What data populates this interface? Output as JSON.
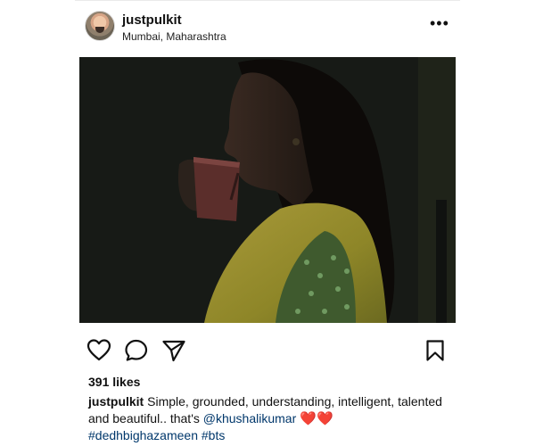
{
  "post": {
    "username": "justpulkit",
    "location": "Mumbai, Maharashtra",
    "more_icon": "more-dots-icon",
    "likes": "391 likes",
    "caption": {
      "username": "justpulkit",
      "text": " Simple, grounded, understanding, intelligent, talented and beautiful.. that's ",
      "mention": "@khushalikumar",
      "emoji": " ❤️❤️",
      "hashtags": "#dedhbighazameen #bts"
    },
    "actions": [
      "heart-icon",
      "comment-icon",
      "share-icon",
      "bookmark-icon"
    ]
  },
  "colors": {
    "link": "#00376b",
    "text": "#111111",
    "background": "#ffffff"
  }
}
